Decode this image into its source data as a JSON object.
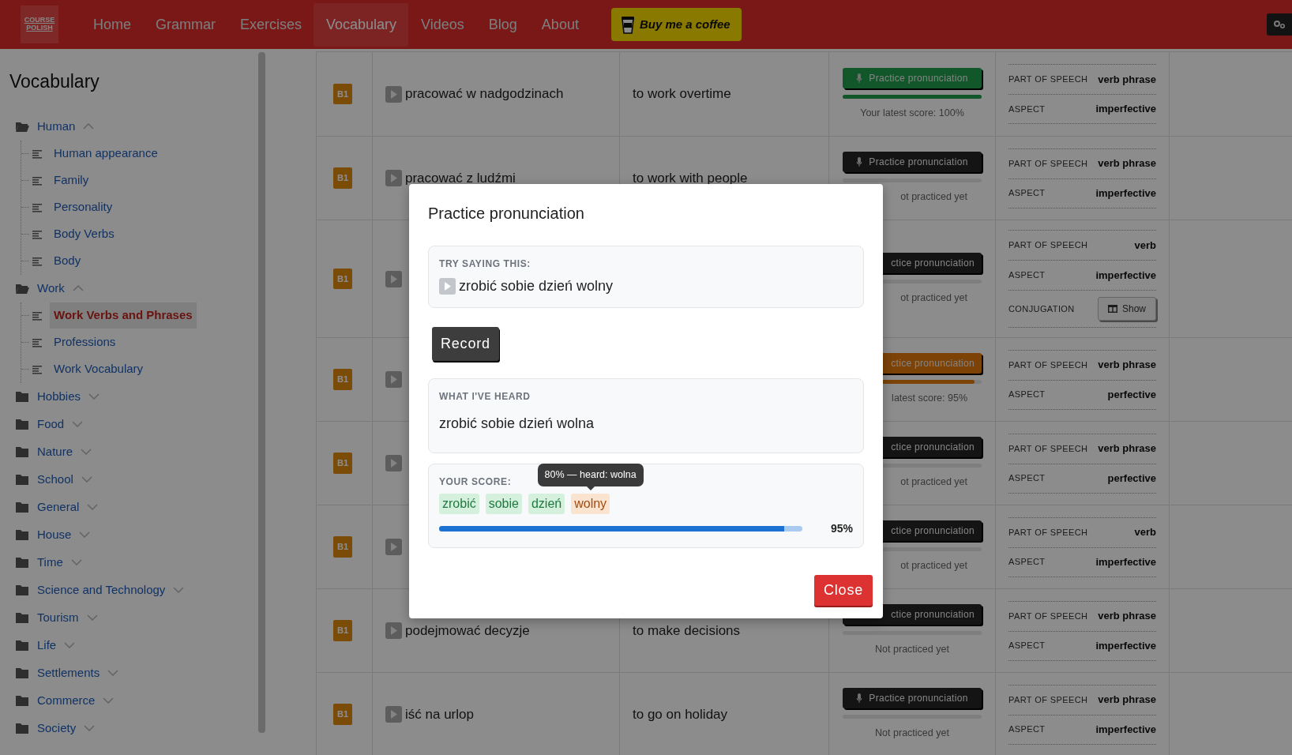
{
  "navbar": {
    "logo": [
      "COURSE",
      "POLISH"
    ],
    "links": [
      {
        "label": "Home",
        "selected": false
      },
      {
        "label": "Grammar",
        "selected": false
      },
      {
        "label": "Exercises",
        "selected": false
      },
      {
        "label": "Vocabulary",
        "selected": true
      },
      {
        "label": "Videos",
        "selected": false
      },
      {
        "label": "Blog",
        "selected": false
      },
      {
        "label": "About",
        "selected": false
      }
    ],
    "coffee_button": "Buy me a coffee"
  },
  "sidebar": {
    "title": "Vocabulary",
    "groups": [
      {
        "label": "Human",
        "expanded": true,
        "children": [
          {
            "label": "Human appearance",
            "selected": false
          },
          {
            "label": "Family",
            "selected": false
          },
          {
            "label": "Personality",
            "selected": false
          },
          {
            "label": "Body Verbs",
            "selected": false
          },
          {
            "label": "Body",
            "selected": false
          }
        ]
      },
      {
        "label": "Work",
        "expanded": true,
        "children": [
          {
            "label": "Work Verbs and Phrases",
            "selected": true
          },
          {
            "label": "Professions",
            "selected": false
          },
          {
            "label": "Work Vocabulary",
            "selected": false
          }
        ]
      },
      {
        "label": "Hobbies",
        "expanded": false
      },
      {
        "label": "Food",
        "expanded": false
      },
      {
        "label": "Nature",
        "expanded": false
      },
      {
        "label": "School",
        "expanded": false
      },
      {
        "label": "General",
        "expanded": false
      },
      {
        "label": "House",
        "expanded": false
      },
      {
        "label": "Time",
        "expanded": false
      },
      {
        "label": "Science and Technology",
        "expanded": false
      },
      {
        "label": "Tourism",
        "expanded": false
      },
      {
        "label": "Life",
        "expanded": false
      },
      {
        "label": "Settlements",
        "expanded": false
      },
      {
        "label": "Commerce",
        "expanded": false
      },
      {
        "label": "Society",
        "expanded": false
      }
    ]
  },
  "table": {
    "rows": [
      {
        "level": "B1",
        "polish": "pracować w nadgodzinach",
        "english": "to work overtime",
        "practice": {
          "kind": "passed",
          "button": {
            "label": "Practice pronunciation",
            "covered": false
          },
          "level": 1,
          "note": {
            "text": "Your latest score: 100%",
            "covered": false
          }
        },
        "details": [
          {
            "label": "PART OF SPEECH",
            "value": "verb phrase"
          },
          {
            "label": "ASPECT",
            "value": "imperfective"
          }
        ]
      },
      {
        "level": "B1",
        "polish": "pracować z ludźmi",
        "english": "to work with people",
        "practice": {
          "kind": "none",
          "button": {
            "label": "Practice pronunciation",
            "covered": false
          },
          "level": 0,
          "note": {
            "text": "ot practiced yet",
            "covered": true
          }
        },
        "details": [
          {
            "label": "PART OF SPEECH",
            "value": "verb phrase"
          },
          {
            "label": "ASPECT",
            "value": "imperfective"
          }
        ]
      },
      {
        "level": "B1",
        "practice": {
          "kind": "none",
          "button": {
            "label": "ctice pronunciation",
            "covered": true
          },
          "level": 0,
          "note": {
            "text": "ot practiced yet",
            "covered": true
          }
        },
        "details": [
          {
            "label": "PART OF SPEECH",
            "value": "verb"
          },
          {
            "label": "ASPECT",
            "value": "imperfective"
          },
          {
            "label": "CONJUGATION",
            "button": "Show"
          }
        ]
      },
      {
        "level": "B1",
        "practice": {
          "kind": "partial",
          "button": {
            "label": "ctice pronunciation",
            "covered": true
          },
          "level": 0.95,
          "note": {
            "text": "latest score: 95%",
            "covered": true
          }
        },
        "details": [
          {
            "label": "PART OF SPEECH",
            "value": "verb phrase"
          },
          {
            "label": "ASPECT",
            "value": "perfective"
          }
        ]
      },
      {
        "level": "B1",
        "practice": {
          "kind": "none",
          "button": {
            "label": "ctice pronunciation",
            "covered": true
          },
          "level": 0,
          "note": {
            "text": "ot practiced yet",
            "covered": true
          }
        },
        "details": [
          {
            "label": "PART OF SPEECH",
            "value": "verb phrase"
          },
          {
            "label": "ASPECT",
            "value": "perfective"
          }
        ]
      },
      {
        "level": "B1",
        "practice": {
          "kind": "none",
          "button": {
            "label": "ctice pronunciation",
            "covered": true
          },
          "level": 0,
          "note": {
            "text": "ot practiced yet",
            "covered": true
          }
        },
        "details": [
          {
            "label": "PART OF SPEECH",
            "value": "verb"
          },
          {
            "label": "ASPECT",
            "value": "imperfective"
          }
        ]
      },
      {
        "level": "B1",
        "polish": "podejmować decyzje",
        "english": "to make decisions",
        "practice": {
          "kind": "none",
          "button": {
            "label": "ctice pronunciation",
            "covered": true
          },
          "level": 0,
          "note": {
            "text": "Not practiced yet",
            "covered": false
          }
        },
        "details": [
          {
            "label": "PART OF SPEECH",
            "value": "verb phrase"
          },
          {
            "label": "ASPECT",
            "value": "imperfective"
          }
        ]
      },
      {
        "level": "B1",
        "polish": "iść na urlop",
        "english": "to go on holiday",
        "practice": {
          "kind": "none",
          "button": {
            "label": "Practice pronunciation",
            "covered": false
          },
          "level": 0,
          "note": {
            "text": "Not practiced yet",
            "covered": false
          }
        },
        "details": [
          {
            "label": "PART OF SPEECH",
            "value": "verb phrase"
          },
          {
            "label": "ASPECT",
            "value": "imperfective"
          }
        ]
      }
    ]
  },
  "modal": {
    "title": "Practice pronunciation",
    "prompt": {
      "label": "TRY SAYING THIS:",
      "phrase": "zrobić sobie dzień wolny"
    },
    "record_button": "Record",
    "heard": {
      "label": "WHAT I'VE HEARD",
      "text": "zrobić sobie dzień wolna"
    },
    "score": {
      "label": "YOUR SCORE:",
      "words": [
        {
          "text": "zrobić",
          "kind": "match"
        },
        {
          "text": "sobie",
          "kind": "match"
        },
        {
          "text": "dzień",
          "kind": "match"
        },
        {
          "text": "wolny",
          "kind": "partial",
          "tooltip": "80% — heard: wolna"
        }
      ],
      "level": 0.95,
      "reading": "95%"
    },
    "close_button": "Close"
  }
}
